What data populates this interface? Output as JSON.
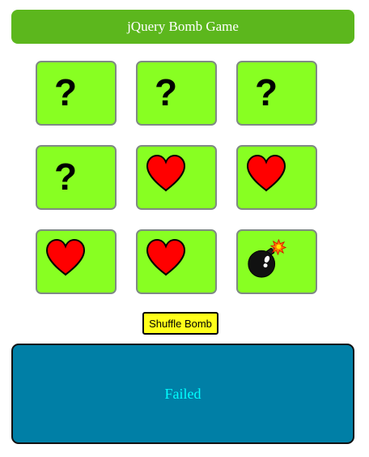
{
  "header": {
    "title": "jQuery Bomb Game"
  },
  "board": {
    "cards": [
      {
        "state": "hidden",
        "icon": "question-mark-icon",
        "label": "?"
      },
      {
        "state": "hidden",
        "icon": "question-mark-icon",
        "label": "?"
      },
      {
        "state": "hidden",
        "icon": "question-mark-icon",
        "label": "?"
      },
      {
        "state": "hidden",
        "icon": "question-mark-icon",
        "label": "?"
      },
      {
        "state": "revealed",
        "icon": "heart-icon"
      },
      {
        "state": "revealed",
        "icon": "heart-icon"
      },
      {
        "state": "revealed",
        "icon": "heart-icon"
      },
      {
        "state": "revealed",
        "icon": "heart-icon"
      },
      {
        "state": "revealed",
        "icon": "bomb-icon"
      }
    ]
  },
  "controls": {
    "shuffle_label": "Shuffle Bomb"
  },
  "result": {
    "message": "Failed"
  },
  "colors": {
    "header_bg": "#5cb71d",
    "card_bg": "#88ff22",
    "card_border": "#7f8a84",
    "button_bg": "#ffff1a",
    "panel_bg": "#007fa6",
    "panel_text": "#00ffff",
    "heart": "#ff0000"
  }
}
